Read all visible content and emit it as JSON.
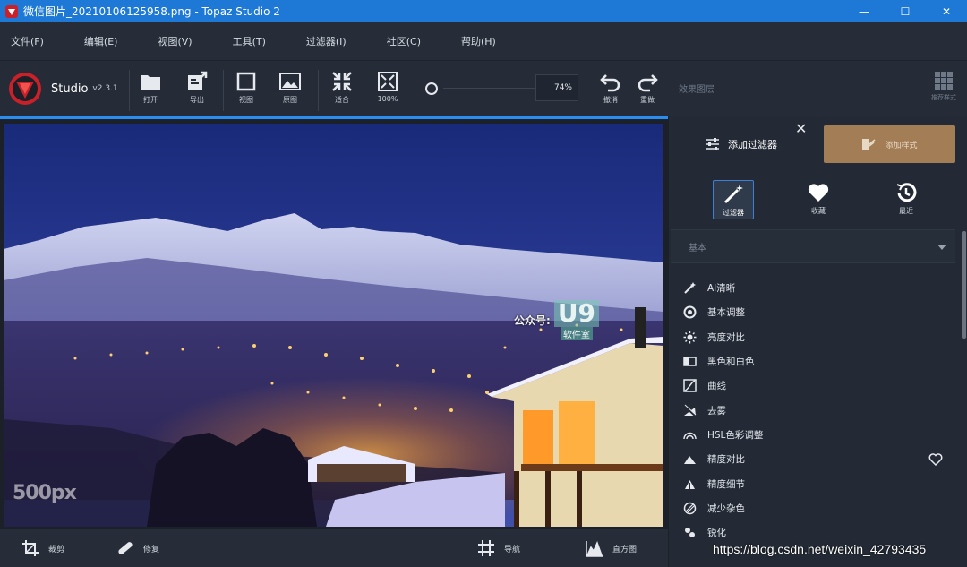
{
  "window": {
    "title": "微信图片_20210106125958.png - Topaz Studio 2",
    "minimize": "—",
    "maximize": "☐",
    "close": "✕"
  },
  "menu": [
    "文件(F)",
    "编辑(E)",
    "视图(V)",
    "工具(T)",
    "过滤器(I)",
    "社区(C)",
    "帮助(H)"
  ],
  "brand": {
    "name": "Studio",
    "version": "v2.3.1"
  },
  "toolbar": {
    "open": "打开",
    "export": "导出",
    "view": "视图",
    "original": "原图",
    "fit": "适合",
    "zoom100": "100%",
    "zoom_value": "74%",
    "undo": "撤消",
    "redo": "重做",
    "layers": "效果图层",
    "presets": "推荐样式"
  },
  "panel": {
    "add_filter": "添加过滤器",
    "close": "✕",
    "add_style": "添加样式",
    "tabs": {
      "filters": "过滤器",
      "favorites": "收藏",
      "recent": "最近"
    },
    "section": "基本",
    "filters": [
      {
        "label": "AI清晰",
        "icon": "magic-wand-icon"
      },
      {
        "label": "基本调整",
        "icon": "aperture-icon"
      },
      {
        "label": "亮度对比",
        "icon": "sun-icon"
      },
      {
        "label": "黑色和白色",
        "icon": "bw-icon"
      },
      {
        "label": "曲线",
        "icon": "curve-icon"
      },
      {
        "label": "去雾",
        "icon": "dehaze-icon"
      },
      {
        "label": "HSL色彩调整",
        "icon": "hsl-icon"
      },
      {
        "label": "精度对比",
        "icon": "mountain-icon"
      },
      {
        "label": "精度细节",
        "icon": "detail-icon"
      },
      {
        "label": "减少杂色",
        "icon": "noise-icon"
      },
      {
        "label": "锐化",
        "icon": "sharpen-icon"
      }
    ]
  },
  "bottom": {
    "crop": "裁剪",
    "repair": "修复",
    "navigate": "导航",
    "histogram": "直方图"
  },
  "watermarks": {
    "site500": "500px",
    "pub": "公众号:",
    "u9": "U9",
    "u9sub": "软件室"
  },
  "overlay_url": "https://blog.csdn.net/weixin_42793435",
  "colors": {
    "accent": "#2a8ef0",
    "titlebar": "#1d78d6",
    "add_style": "#a27d55"
  }
}
